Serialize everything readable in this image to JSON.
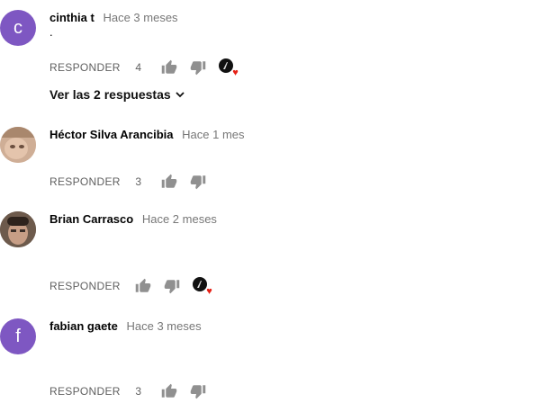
{
  "comments": [
    {
      "author": "cinthia t",
      "time": "Hace 3 meses",
      "avatar_letter": "c",
      "text": ".",
      "reply_label": "RESPONDER",
      "likes": "4",
      "creator_heart": true
    },
    {
      "author": "Héctor Silva Arancibia",
      "time": "Hace 1 mes",
      "avatar_letter": "",
      "reply_label": "RESPONDER",
      "likes": "3",
      "creator_heart": false
    },
    {
      "author": "Brian Carrasco",
      "time": "Hace 2 meses",
      "avatar_letter": "",
      "reply_label": "RESPONDER",
      "likes": "",
      "creator_heart": true
    },
    {
      "author": "fabian gaete",
      "time": "Hace 3 meses",
      "avatar_letter": "f",
      "reply_label": "RESPONDER",
      "likes": "3",
      "creator_heart": false
    }
  ],
  "replies_toggle": {
    "label": "Ver las 2 respuestas"
  },
  "colors": {
    "avatar_purple": "#7e57c2",
    "heart_red": "#e62117",
    "muted_text": "#606060"
  },
  "icons": [
    "thumb-up-icon",
    "thumb-down-icon",
    "creator-heart-icon",
    "chevron-down-icon"
  ]
}
